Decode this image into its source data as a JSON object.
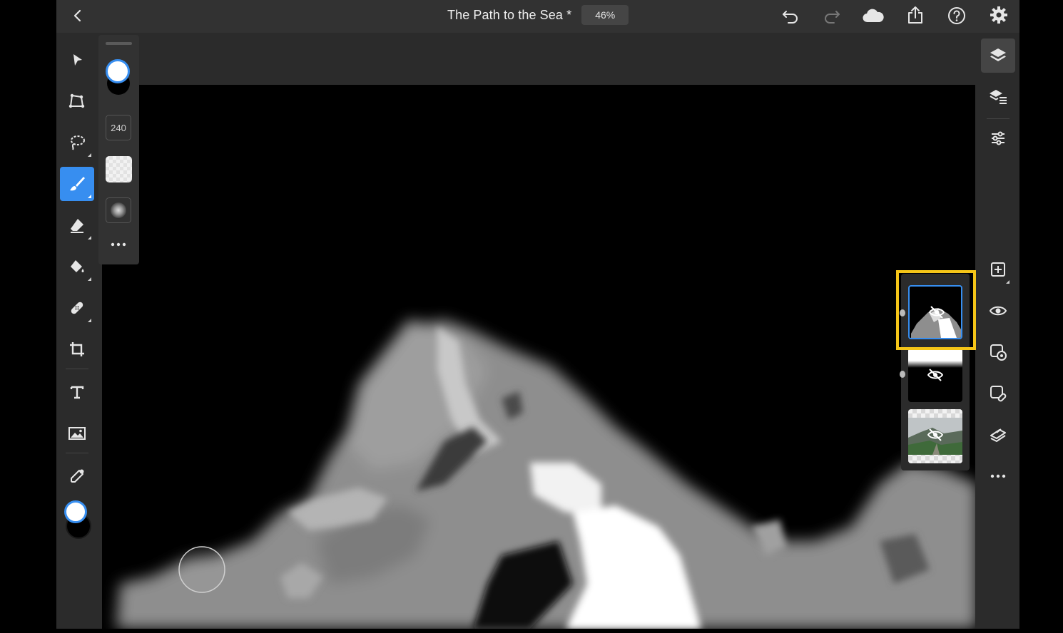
{
  "header": {
    "title": "The Path to the Sea *",
    "zoom": "46%"
  },
  "options": {
    "brush_size": "240"
  },
  "colors": {
    "accent": "#378ef0",
    "highlight": "#f5c518",
    "foreground_swatch": "#ffffff",
    "background_swatch": "#000000"
  },
  "icons": {
    "back": "chevron-left-icon",
    "undo": "undo-icon",
    "redo": "redo-icon",
    "cloud": "cloud-icon",
    "share": "share-icon",
    "help": "help-icon",
    "settings": "gear-icon"
  },
  "left_tools": [
    "select",
    "transform",
    "lasso",
    "brush",
    "eraser",
    "fill",
    "healing",
    "crop",
    "type",
    "place-image",
    "eyedropper"
  ],
  "right_tools": [
    "layers",
    "layer-properties",
    "adjustments",
    "add-layer",
    "visibility",
    "mask",
    "clipping",
    "blend",
    "more"
  ]
}
